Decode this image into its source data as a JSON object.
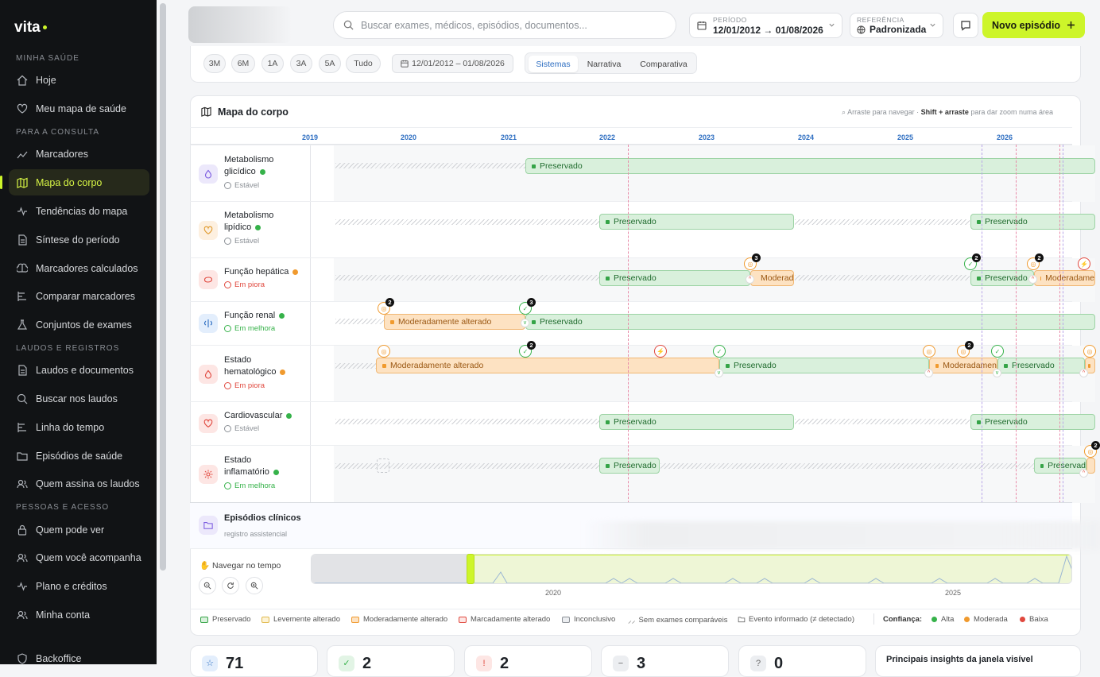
{
  "brand": {
    "name": "vita"
  },
  "sidebar": {
    "sections": [
      "MINHA SAÚDE",
      "PARA A CONSULTA",
      "LAUDOS E REGISTROS",
      "PESSOAS E ACESSO"
    ],
    "items": [
      {
        "label": "Hoje",
        "icon": "home-icon"
      },
      {
        "label": "Meu mapa de saúde",
        "icon": "heart-icon"
      },
      {
        "label": "Marcadores",
        "icon": "trend-icon"
      },
      {
        "label": "Mapa do corpo",
        "icon": "map-icon"
      },
      {
        "label": "Tendências do mapa",
        "icon": "pulse-icon"
      },
      {
        "label": "Síntese do período",
        "icon": "document-icon"
      },
      {
        "label": "Marcadores calculados",
        "icon": "brain-icon"
      },
      {
        "label": "Comparar marcadores",
        "icon": "compare-icon"
      },
      {
        "label": "Conjuntos de exames",
        "icon": "flask-icon"
      },
      {
        "label": "Laudos e documentos",
        "icon": "file-icon"
      },
      {
        "label": "Buscar nos laudos",
        "icon": "search-icon"
      },
      {
        "label": "Linha do tempo",
        "icon": "timeline-icon"
      },
      {
        "label": "Episódios de saúde",
        "icon": "folder-icon"
      },
      {
        "label": "Quem assina os laudos",
        "icon": "users-icon"
      },
      {
        "label": "Quem pode ver",
        "icon": "lock-icon"
      },
      {
        "label": "Quem você acompanha",
        "icon": "users-icon"
      },
      {
        "label": "Plano e créditos",
        "icon": "pulse-icon"
      },
      {
        "label": "Minha conta",
        "icon": "user-icon"
      },
      {
        "label": "Backoffice",
        "icon": "shield-icon"
      }
    ]
  },
  "topbar": {
    "search_placeholder": "Buscar exames, médicos, episódios, documentos...",
    "period_label": "PERÍODO",
    "period_value": "12/01/2012 → 01/08/2026",
    "reference_label": "REFERÊNCIA",
    "reference_value": "Padronizada",
    "new_button": "Novo episódio"
  },
  "filters": {
    "ranges": [
      "3M",
      "6M",
      "1A",
      "3A",
      "5A",
      "Tudo"
    ],
    "date_range": "12/01/2012 – 01/08/2026",
    "views": [
      "Sistemas",
      "Narrativa",
      "Comparativa"
    ],
    "active_view": "Sistemas"
  },
  "body_map": {
    "title": "Mapa do corpo",
    "hint_prefix": "Arraste para navegar ·",
    "hint_bold": "Shift + arraste",
    "hint_suffix": "para dar zoom numa área",
    "years": [
      "2019",
      "2020",
      "2021",
      "2022",
      "2023",
      "2024",
      "2025",
      "2026"
    ],
    "rows": [
      {
        "name_l1": "Metabolismo",
        "name_l2": "glicídico",
        "status": "Estável",
        "confidence_color": "#36b24a",
        "status_color": "#8b9096",
        "icon": "drop-icon",
        "bars": [
          {
            "type": "g",
            "label": "Preservado"
          }
        ]
      },
      {
        "name_l1": "Metabolismo",
        "name_l2": "lipídico",
        "status": "Estável",
        "confidence_color": "#36b24a",
        "status_color": "#8b9096",
        "icon": "heart-icon",
        "bars": [
          {
            "type": "g",
            "label": "Preservado"
          },
          {
            "type": "g",
            "label": "Preservado"
          }
        ]
      },
      {
        "name_l1": "Função hepática",
        "name_l2": "",
        "status": "Em piora",
        "confidence_color": "#f09a2e",
        "status_color": "#e0483e",
        "icon": "liver-icon",
        "bars": [
          {
            "type": "g",
            "label": "Preservado"
          },
          {
            "type": "o",
            "label": "Moderada"
          },
          {
            "type": "g",
            "label": "Preservado"
          },
          {
            "type": "o",
            "label": "Moderadame"
          }
        ]
      },
      {
        "name_l1": "Função renal",
        "name_l2": "",
        "status": "Em melhora",
        "confidence_color": "#36b24a",
        "status_color": "#36b24a",
        "icon": "kidney-icon",
        "bars": [
          {
            "type": "o",
            "label": "Moderadamente alterado"
          },
          {
            "type": "g",
            "label": "Preservado"
          }
        ]
      },
      {
        "name_l1": "Estado",
        "name_l2": "hematológico",
        "status": "Em piora",
        "confidence_color": "#f09a2e",
        "status_color": "#e0483e",
        "icon": "blood-icon",
        "bars": [
          {
            "type": "o",
            "label": "Moderadamente alterado"
          },
          {
            "type": "g",
            "label": "Preservado"
          },
          {
            "type": "o",
            "label": "Moderadamen"
          },
          {
            "type": "g",
            "label": "Preservado"
          }
        ]
      },
      {
        "name_l1": "Cardiovascular",
        "name_l2": "",
        "status": "Estável",
        "confidence_color": "#36b24a",
        "status_color": "#8b9096",
        "icon": "heart-icon",
        "bars": [
          {
            "type": "g",
            "label": "Preservado"
          },
          {
            "type": "g",
            "label": "Preservado"
          }
        ]
      },
      {
        "name_l1": "Estado",
        "name_l2": "inflamatório",
        "status": "Em melhora",
        "confidence_color": "#36b24a",
        "status_color": "#36b24a",
        "icon": "sun-icon",
        "bars": [
          {
            "type": "g",
            "label": "Preservado"
          },
          {
            "type": "g",
            "label": "Preservad"
          }
        ]
      }
    ],
    "marker_counts": [
      "3",
      "2",
      "2",
      "2",
      "3",
      "2",
      "2",
      "2"
    ],
    "episodes": {
      "title": "Episódios clínicos",
      "subtitle": "registro assistencial"
    },
    "navigator": {
      "label": "Navegar no tempo",
      "ticks": [
        "2020",
        "2025"
      ]
    }
  },
  "legend": {
    "items": [
      "Preservado",
      "Levemente alterado",
      "Moderadamente alterado",
      "Marcadamente alterado",
      "Inconclusivo",
      "Sem exames comparáveis",
      "Evento informado (≠ detectado)"
    ],
    "confidence_label": "Confiança:",
    "confidence": [
      {
        "label": "Alta",
        "color": "#36b24a"
      },
      {
        "label": "Moderada",
        "color": "#f09a2e"
      },
      {
        "label": "Baixa",
        "color": "#e0483e"
      }
    ]
  },
  "summary_cards": [
    {
      "value": "71"
    },
    {
      "value": "2"
    },
    {
      "value": "2"
    },
    {
      "value": "3"
    },
    {
      "value": "0"
    }
  ],
  "insights_title": "Principais insights da janela visível"
}
